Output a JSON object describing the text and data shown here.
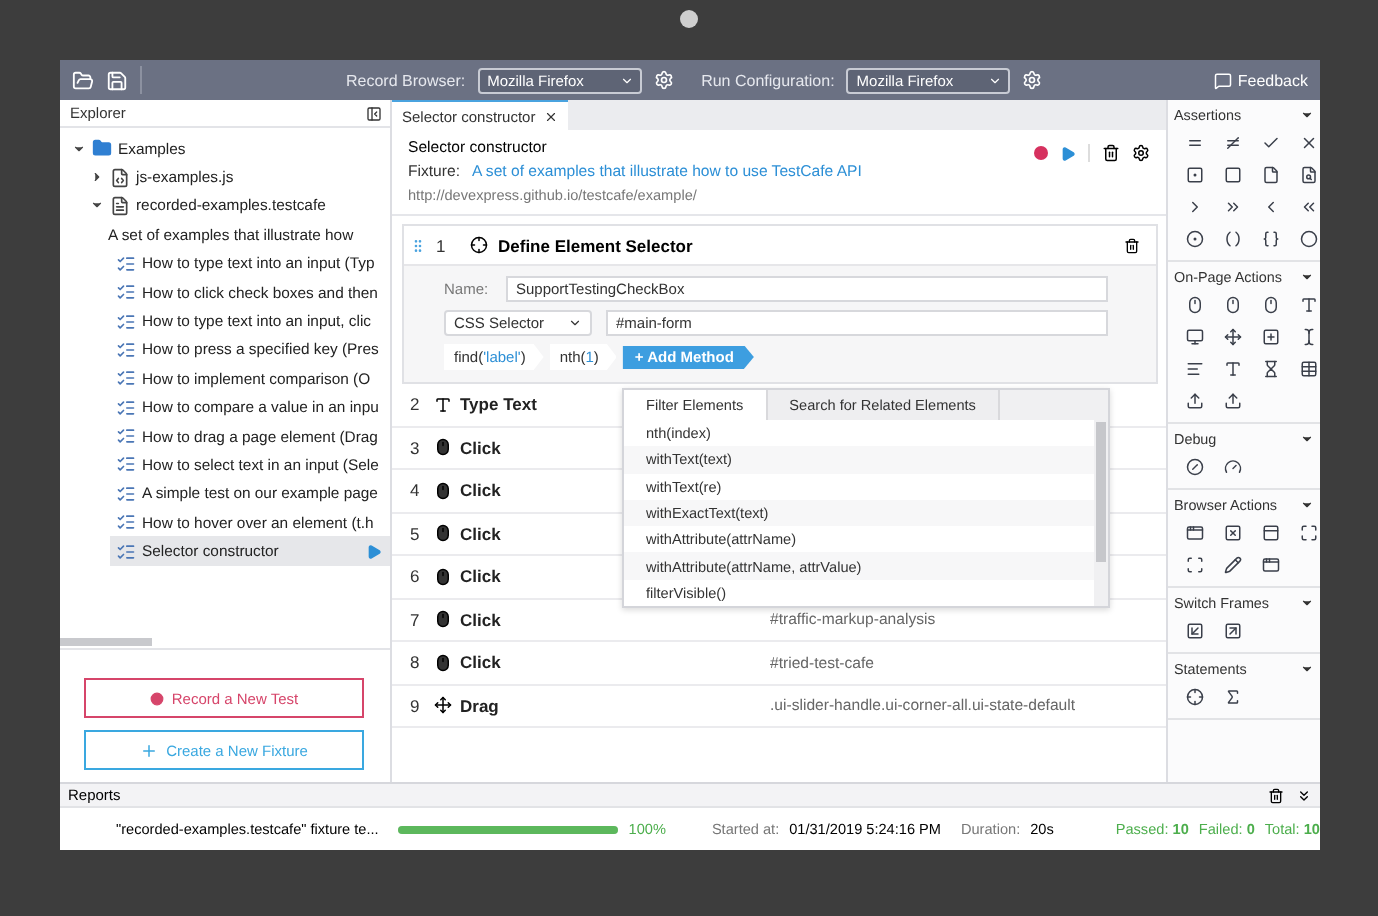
{
  "toolbar": {
    "record_browser": {
      "label": "Record Browser:",
      "value": "Mozilla Firefox"
    },
    "run_configuration": {
      "label": "Run Configuration:",
      "value": "Mozilla Firefox"
    },
    "feedback": "Feedback"
  },
  "explorer": {
    "title": "Explorer",
    "tree": [
      {
        "label": "Examples",
        "kind": "folder",
        "expanded": true,
        "selected": false,
        "children": [
          {
            "label": "js-examples.js",
            "kind": "script",
            "expanded": false,
            "selected": false
          },
          {
            "label": "recorded-examples.testcafe",
            "kind": "fixture",
            "expanded": true,
            "selected": false,
            "children": [
              {
                "label": "A set of examples that illustrate how",
                "kind": "description",
                "selected": false
              },
              {
                "label": "How to type text into an input (Typ",
                "kind": "test",
                "selected": false
              },
              {
                "label": "How to click check boxes and then",
                "kind": "test",
                "selected": false
              },
              {
                "label": "How to type text into an input, clic",
                "kind": "test",
                "selected": false
              },
              {
                "label": "How to press a specified key (Pres",
                "kind": "test",
                "selected": false
              },
              {
                "label": "How to implement comparison (O",
                "kind": "test",
                "selected": false
              },
              {
                "label": "How to compare a value in an inpu",
                "kind": "test",
                "selected": false
              },
              {
                "label": "How to drag a page element (Drag",
                "kind": "test",
                "selected": false
              },
              {
                "label": "How to select text in an input (Sele",
                "kind": "test",
                "selected": false
              },
              {
                "label": "A simple test on our example page",
                "kind": "test",
                "selected": false
              },
              {
                "label": "How to hover over an element (t.h",
                "kind": "test",
                "selected": false
              },
              {
                "label": "Selector constructor",
                "kind": "test",
                "selected": true
              }
            ]
          }
        ]
      }
    ],
    "buttons": [
      {
        "label": "Record a New Test",
        "kind": "record"
      },
      {
        "label": "Create a New Fixture",
        "kind": "create"
      }
    ]
  },
  "tab": {
    "label": "Selector constructor"
  },
  "test": {
    "title": "Selector constructor",
    "fixture_label": "Fixture:",
    "fixture_link": "A set of examples that illustrate how to use TestCafe API",
    "url": "http://devexpress.github.io/testcafe/example/"
  },
  "selector_step": {
    "number": "1",
    "title": "Define Element Selector",
    "name_label": "Name:",
    "name_value": "SupportTestingCheckBox",
    "selector_type": "CSS Selector",
    "selector_value": "#main-form",
    "methods": [
      {
        "name": "find(",
        "arg": "'label'",
        "close": ")"
      },
      {
        "name": "nth(",
        "arg": "1",
        "close": ")"
      }
    ],
    "add_method": "+ Add Method"
  },
  "method_menu": {
    "tabs": [
      {
        "label": "Filter Elements",
        "selected": true
      },
      {
        "label": "Search for Related Elements",
        "selected": false
      }
    ],
    "items": [
      "nth(index)",
      "withText(text)",
      "withText(re)",
      "withExactText(text)",
      "withAttribute(attrName)",
      "withAttribute(attrName, attrValue)",
      "filterVisible()"
    ]
  },
  "steps": [
    {
      "number": "2",
      "kind": "type",
      "name": "Type Text"
    },
    {
      "number": "3",
      "kind": "click",
      "name": "Click"
    },
    {
      "number": "4",
      "kind": "click",
      "name": "Click"
    },
    {
      "number": "5",
      "kind": "click",
      "name": "Click"
    },
    {
      "number": "6",
      "kind": "click",
      "name": "Click"
    },
    {
      "number": "7",
      "kind": "click",
      "name": "Click",
      "selector": "#traffic-markup-analysis"
    },
    {
      "number": "8",
      "kind": "click",
      "name": "Click",
      "selector": "#tried-test-cafe"
    },
    {
      "number": "9",
      "kind": "drag",
      "name": "Drag",
      "selector": ".ui-slider-handle.ui-corner-all.ui-state-default"
    }
  ],
  "tools": [
    {
      "title": "Assertions",
      "kind": "assertions"
    },
    {
      "title": "On-Page Actions",
      "kind": "actions"
    },
    {
      "title": "Debug",
      "kind": "debug"
    },
    {
      "title": "Browser Actions",
      "kind": "browser"
    },
    {
      "title": "Switch Frames",
      "kind": "frames"
    },
    {
      "title": "Statements",
      "kind": "statements"
    }
  ],
  "reports": {
    "title": "Reports",
    "fixture": "\"recorded-examples.testcafe\" fixture te...",
    "level": 1.0,
    "percent": "100%",
    "started_label": "Started at:",
    "started_value": "01/31/2019 5:24:16 PM",
    "duration_label": "Duration:",
    "duration_value": "20s",
    "passed_label": "Passed:",
    "passed": "10",
    "failed_label": "Failed:",
    "failed": "0",
    "total_label": "Total:",
    "total": "10"
  }
}
